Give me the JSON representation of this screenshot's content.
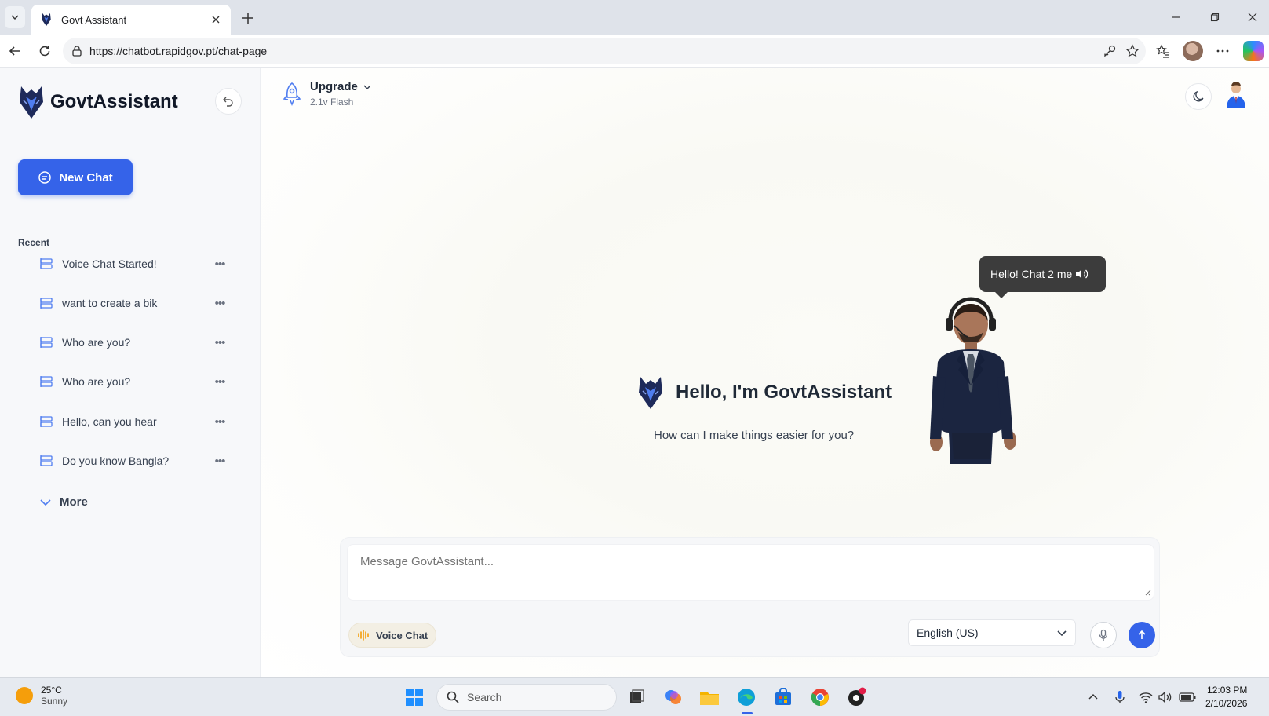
{
  "browser": {
    "tab_title": "Govt Assistant",
    "url": "https://chatbot.rapidgov.pt/chat-page"
  },
  "sidebar": {
    "brand": "GovtAssistant",
    "new_chat_label": "New Chat",
    "recent_label": "Recent",
    "recent_items": [
      {
        "label": "Voice Chat Started!"
      },
      {
        "label": "want to create a bik"
      },
      {
        "label": "Who are you?"
      },
      {
        "label": "Who are you?"
      },
      {
        "label": "Hello, can you hear"
      },
      {
        "label": "Do you know Bangla?"
      }
    ],
    "more_label": "More"
  },
  "header": {
    "upgrade_label": "Upgrade",
    "model_label": "2.1v Flash"
  },
  "hero": {
    "title": "Hello, I'm GovtAssistant",
    "subtitle": "How can I make things easier for you?"
  },
  "avatar": {
    "bubble_text": "Hello! Chat 2 me"
  },
  "composer": {
    "placeholder": "Message GovtAssistant...",
    "voice_chat_label": "Voice Chat",
    "language_value": "English (US)"
  },
  "taskbar": {
    "temperature": "25°C",
    "weather": "Sunny",
    "search_label": "Search",
    "time": "12:03 PM",
    "date": "2/10/2026"
  },
  "colors": {
    "accent": "#3563e9",
    "sidebar_bg": "#f7f8fa",
    "bubble_bg": "#3c3c3c"
  }
}
